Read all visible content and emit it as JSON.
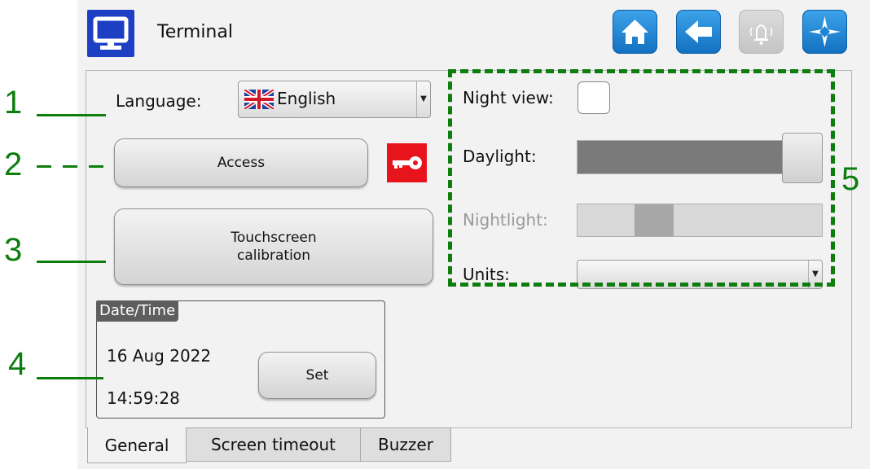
{
  "header": {
    "title": "Terminal",
    "icons": [
      "monitor-icon",
      "home-icon",
      "back-icon",
      "bell-icon",
      "compass-icon"
    ]
  },
  "general": {
    "language_label": "Language:",
    "language_value": "English",
    "access_label": "Access",
    "calibration_label": "Touchscreen\ncalibration",
    "night_view_label": "Night view:",
    "night_view_checked": false,
    "daylight_label": "Daylight:",
    "daylight_level": 1.0,
    "nightlight_label": "Nightlight:",
    "nightlight_level": 0.25,
    "units_label": "Units:",
    "units_value": ""
  },
  "datetime": {
    "title": "Date/Time",
    "date": "16 Aug 2022",
    "time": "14:59:28",
    "set_label": "Set"
  },
  "tabs": [
    {
      "label": "General",
      "active": true
    },
    {
      "label": "Screen timeout",
      "active": false
    },
    {
      "label": "Buzzer",
      "active": false
    }
  ],
  "annotations": [
    "1",
    "2",
    "3",
    "4",
    "5"
  ],
  "colors": {
    "annotation": "#0d7d0d",
    "key_badge": "#e8141c",
    "toolbar_button": "#1a85d8",
    "header_icon": "#1c3fc4"
  }
}
